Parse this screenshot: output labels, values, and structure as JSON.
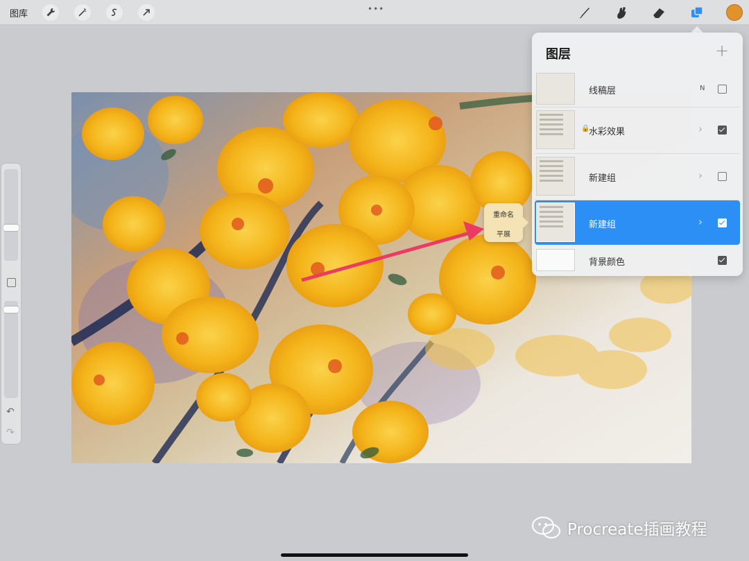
{
  "toolbar": {
    "gallery_label": "图库",
    "left_tools": [
      "wrench-icon",
      "magic-wand-icon",
      "selection-icon",
      "transform-arrow-icon"
    ],
    "right_tools": [
      "brush-icon",
      "smudge-icon",
      "eraser-icon",
      "layers-icon"
    ],
    "grabber": "•••",
    "current_color": "#e1922c"
  },
  "layers_panel": {
    "title": "图层",
    "add_label": "+",
    "layers": [
      {
        "name": "线稿层",
        "blend": "N",
        "visible": false,
        "selected": false,
        "locked": false,
        "is_group": false
      },
      {
        "name": "水彩效果",
        "blend": "",
        "visible": true,
        "selected": false,
        "locked": true,
        "is_group": true
      },
      {
        "name": "新建组",
        "blend": "",
        "visible": false,
        "selected": false,
        "locked": false,
        "is_group": true
      },
      {
        "name": "新建组",
        "blend": "",
        "visible": true,
        "selected": true,
        "locked": false,
        "is_group": true
      },
      {
        "name": "背景颜色",
        "blend": "",
        "visible": true,
        "selected": false,
        "locked": false,
        "is_group": false
      }
    ]
  },
  "context_menu": {
    "items": [
      "重命名",
      "平展"
    ]
  },
  "sidebar": {
    "undo": "↶",
    "redo": "↷"
  },
  "watermark": {
    "text": "Procreate插画教程"
  },
  "colors": {
    "accent": "#2c8ff5",
    "annotation_arrow": "#ec3b63",
    "flower_yellow": "#f4b41a"
  }
}
